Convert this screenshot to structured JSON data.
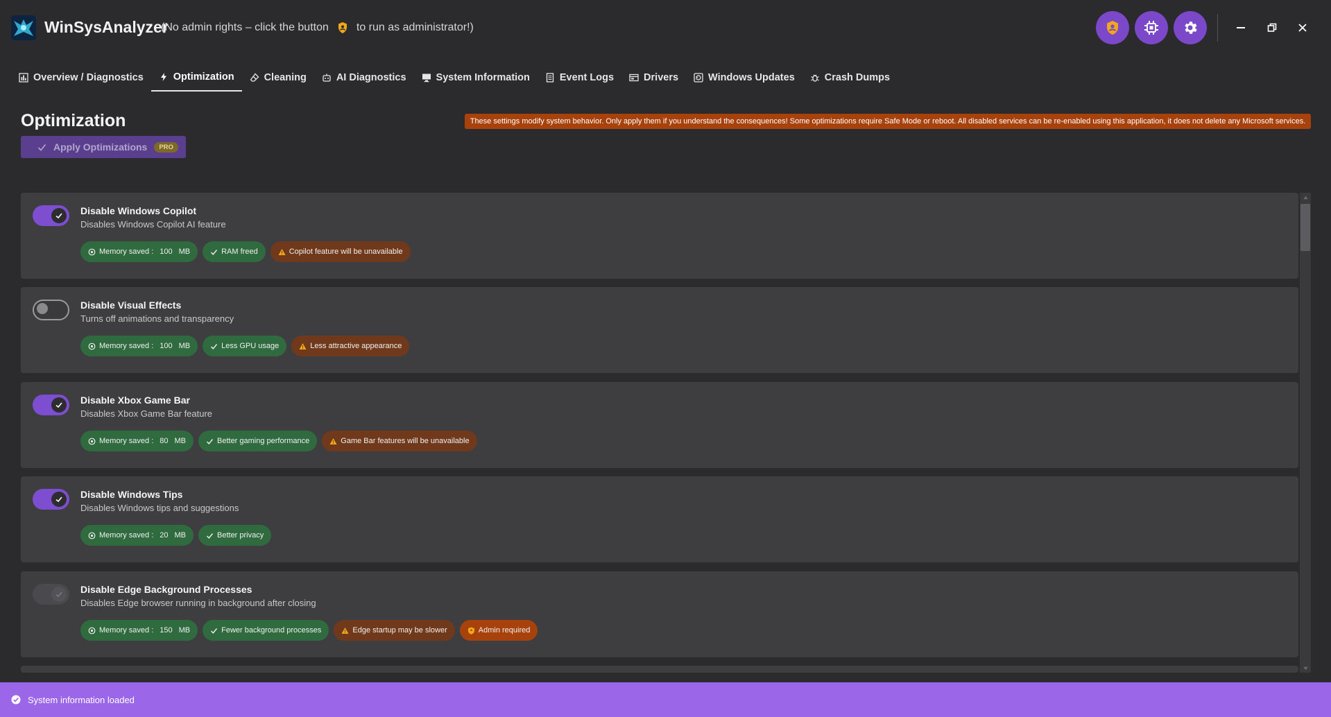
{
  "window": {
    "title": "WinSysAnalyzer",
    "admin_note_prefix": "(No admin rights – click the button",
    "admin_note_suffix": "to run as administrator!)"
  },
  "colors": {
    "accent": "#7a48c8",
    "toggle_on": "#7d4fd0",
    "chip_green": "#2f6b3e",
    "chip_orange": "#71391b",
    "warning": "#a8420c",
    "statusbar": "#9b66e8"
  },
  "title_buttons": [
    {
      "icon": "shield-icon"
    },
    {
      "icon": "chip-icon"
    },
    {
      "icon": "gear-icon"
    }
  ],
  "tabs": [
    {
      "label": "Overview / Diagnostics",
      "icon": "bar-chart-icon"
    },
    {
      "label": "Optimization",
      "icon": "lightning-icon"
    },
    {
      "label": "Cleaning",
      "icon": "eraser-icon"
    },
    {
      "label": "AI Diagnostics",
      "icon": "robot-icon"
    },
    {
      "label": "System Information",
      "icon": "monitor-icon"
    },
    {
      "label": "Event Logs",
      "icon": "document-icon"
    },
    {
      "label": "Drivers",
      "icon": "card-icon"
    },
    {
      "label": "Windows Updates",
      "icon": "update-icon"
    },
    {
      "label": "Crash Dumps",
      "icon": "bug-icon"
    }
  ],
  "page": {
    "title": "Optimization",
    "apply_label": "Apply Optimizations",
    "pro_label": "PRO",
    "warning": "These settings modify system behavior. Only apply them if you understand the consequences! Some optimizations require Safe Mode or reboot. All disabled services can be re-enabled using this application, it does not delete any Microsoft services."
  },
  "optimizations": [
    {
      "title": "Disable Windows Copilot",
      "desc": "Disables Windows Copilot AI feature",
      "state": "on",
      "memory_label": "Memory saved :",
      "memory_value": "100",
      "memory_unit": "MB",
      "benefits": [
        "RAM freed"
      ],
      "warnings": [
        "Copilot feature will be unavailable"
      ],
      "admin": ""
    },
    {
      "title": "Disable Visual Effects",
      "desc": "Turns off animations and transparency",
      "state": "off",
      "memory_label": "Memory saved :",
      "memory_value": "100",
      "memory_unit": "MB",
      "benefits": [
        "Less GPU usage"
      ],
      "warnings": [
        "Less attractive appearance"
      ],
      "admin": ""
    },
    {
      "title": "Disable Xbox Game Bar",
      "desc": "Disables Xbox Game Bar feature",
      "state": "on",
      "memory_label": "Memory saved :",
      "memory_value": "80",
      "memory_unit": "MB",
      "benefits": [
        "Better gaming performance"
      ],
      "warnings": [
        "Game Bar features will be unavailable"
      ],
      "admin": ""
    },
    {
      "title": "Disable Windows Tips",
      "desc": "Disables Windows tips and suggestions",
      "state": "on",
      "memory_label": "Memory saved :",
      "memory_value": "20",
      "memory_unit": "MB",
      "benefits": [
        "Better privacy"
      ],
      "warnings": [],
      "admin": ""
    },
    {
      "title": "Disable Edge Background Processes",
      "desc": "Disables Edge browser running in background after closing",
      "state": "disabled",
      "memory_label": "Memory saved :",
      "memory_value": "150",
      "memory_unit": "MB",
      "benefits": [
        "Fewer background processes"
      ],
      "warnings": [
        "Edge startup may be slower"
      ],
      "admin": "Admin required"
    }
  ],
  "status": {
    "text": "System information loaded"
  }
}
